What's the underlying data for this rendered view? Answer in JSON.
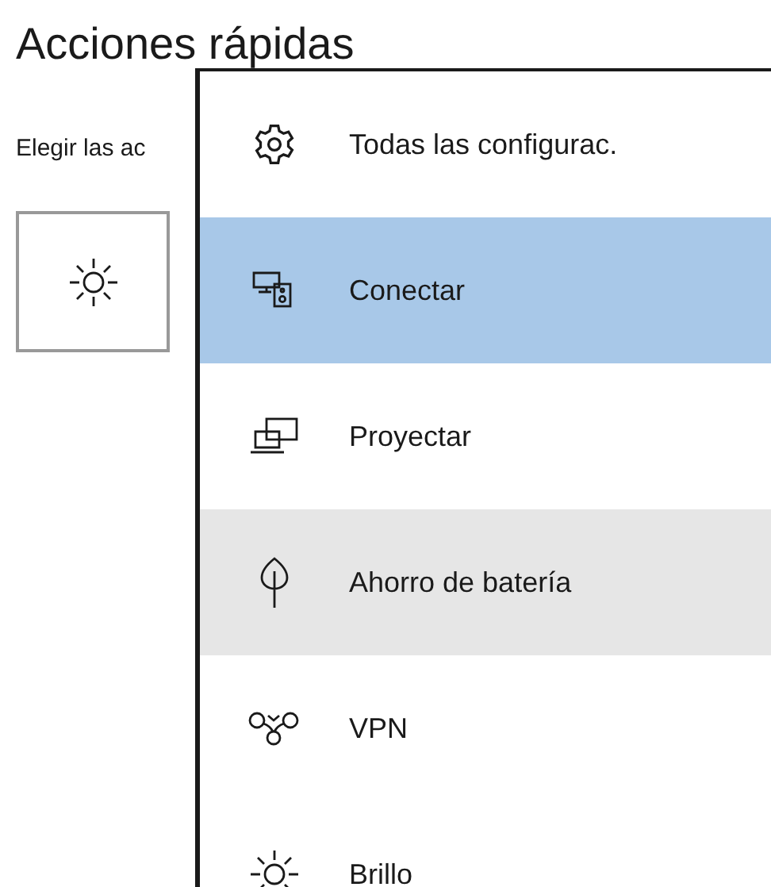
{
  "page": {
    "title": "Acciones rápidas",
    "subtitle": "Elegir las ac"
  },
  "menu": {
    "items": [
      {
        "label": "Todas las configurac.",
        "selected": false,
        "hovered": false
      },
      {
        "label": "Conectar",
        "selected": true,
        "hovered": false
      },
      {
        "label": "Proyectar",
        "selected": false,
        "hovered": false
      },
      {
        "label": "Ahorro de batería",
        "selected": false,
        "hovered": true
      },
      {
        "label": "VPN",
        "selected": false,
        "hovered": false
      },
      {
        "label": "Brillo",
        "selected": false,
        "hovered": false
      }
    ]
  }
}
